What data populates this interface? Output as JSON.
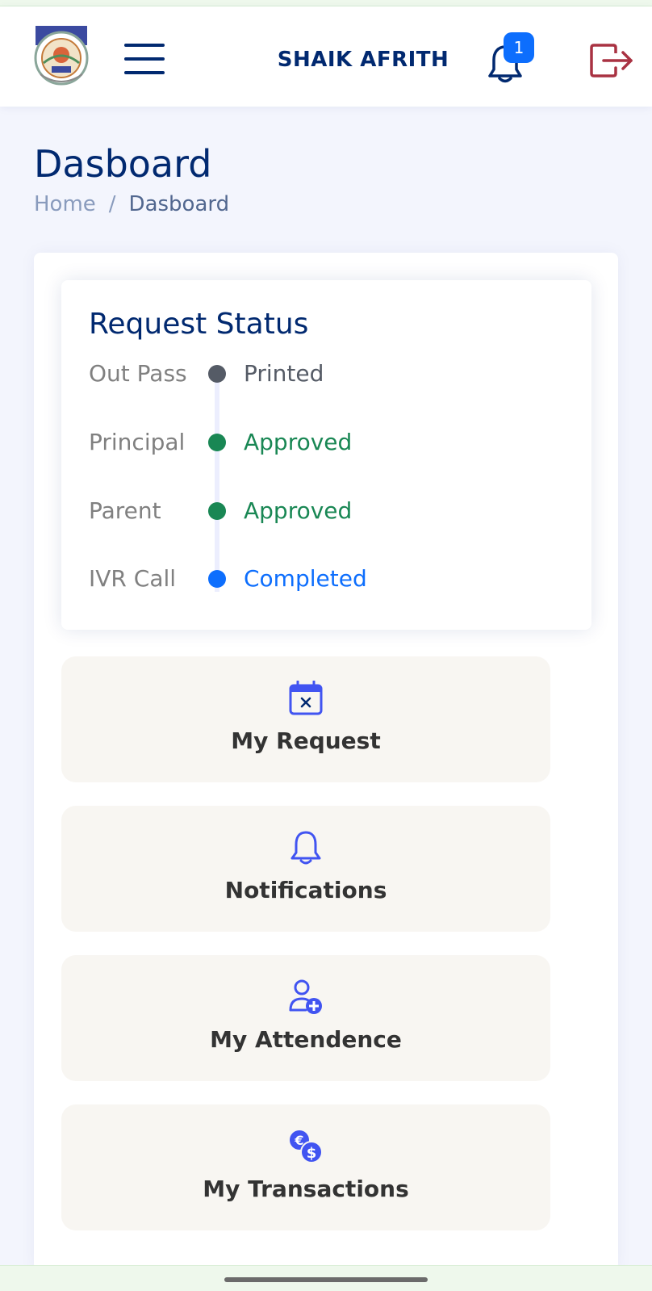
{
  "header": {
    "username": "SHAIK AFRITH",
    "notification_count": "1"
  },
  "page": {
    "title": "Dasboard",
    "breadcrumb": {
      "home": "Home",
      "separator": "/",
      "current": "Dasboard"
    }
  },
  "request_status": {
    "title": "Request Status",
    "steps": [
      {
        "label": "Out Pass",
        "value": "Printed",
        "color": "#555b66"
      },
      {
        "label": "Principal",
        "value": "Approved",
        "color": "#198754"
      },
      {
        "label": "Parent",
        "value": "Approved",
        "color": "#198754"
      },
      {
        "label": "IVR Call",
        "value": "Completed",
        "color": "#0d6efd"
      }
    ]
  },
  "actions": [
    {
      "label": "My Request",
      "icon": "calendar-x-icon"
    },
    {
      "label": "Notifications",
      "icon": "bell-icon"
    },
    {
      "label": "My Attendence",
      "icon": "person-plus-icon"
    },
    {
      "label": "My Transactions",
      "icon": "currency-exchange-icon"
    }
  ],
  "colors": {
    "brand_navy": "#012970",
    "accent_blue": "#0d6efd",
    "success_green": "#198754",
    "logout_red": "#a93242",
    "icon_indigo": "#4154f1",
    "tile_bg": "#f8f6f2"
  }
}
